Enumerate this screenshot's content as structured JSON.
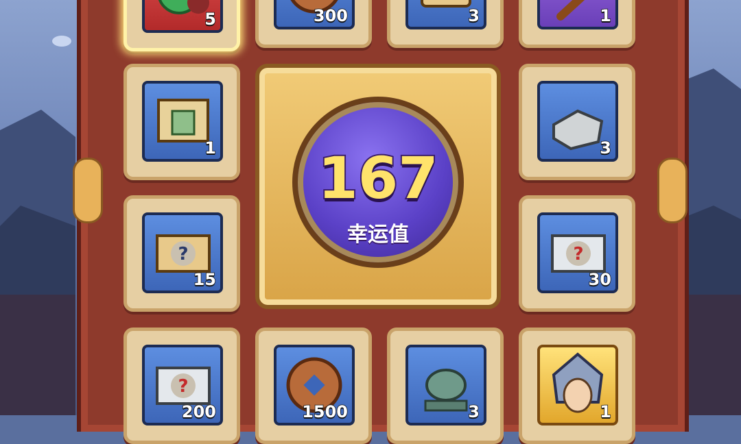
{
  "luck_meter": {
    "value": "167",
    "label": "幸运值"
  },
  "items": [
    {
      "id": "top-1",
      "icon": "jade-orb-icon",
      "count": "5",
      "frame": "red",
      "selected": true
    },
    {
      "id": "top-2",
      "icon": "copper-coin-icon",
      "count": "300",
      "frame": "blue"
    },
    {
      "id": "top-3",
      "icon": "scroll-icon",
      "count": "3",
      "frame": "blue"
    },
    {
      "id": "top-4",
      "icon": "weapon-icon",
      "count": "1",
      "frame": "purple"
    },
    {
      "id": "left-1",
      "icon": "map-scroll-icon",
      "count": "1",
      "frame": "blue"
    },
    {
      "id": "right-1",
      "icon": "stone-block-icon",
      "count": "3",
      "frame": "blue"
    },
    {
      "id": "left-2",
      "icon": "mystery-scroll-icon",
      "count": "15",
      "frame": "blue"
    },
    {
      "id": "right-2",
      "icon": "mystery-scroll-red-icon",
      "count": "30",
      "frame": "blue"
    },
    {
      "id": "bottom-1",
      "icon": "mystery-scroll-red-icon",
      "count": "200",
      "frame": "blue"
    },
    {
      "id": "bottom-2",
      "icon": "copper-coin-icon",
      "count": "1500",
      "frame": "blue"
    },
    {
      "id": "bottom-3",
      "icon": "jade-beast-statue-icon",
      "count": "3",
      "frame": "blue"
    },
    {
      "id": "bottom-4",
      "icon": "hero-portrait-icon",
      "count": "1",
      "frame": "gold"
    }
  ],
  "colors": {
    "board": "#8e3a2c",
    "cell": "#e6cfa3",
    "orb": "#5b41c7",
    "luck_text": "#ffe36b"
  }
}
